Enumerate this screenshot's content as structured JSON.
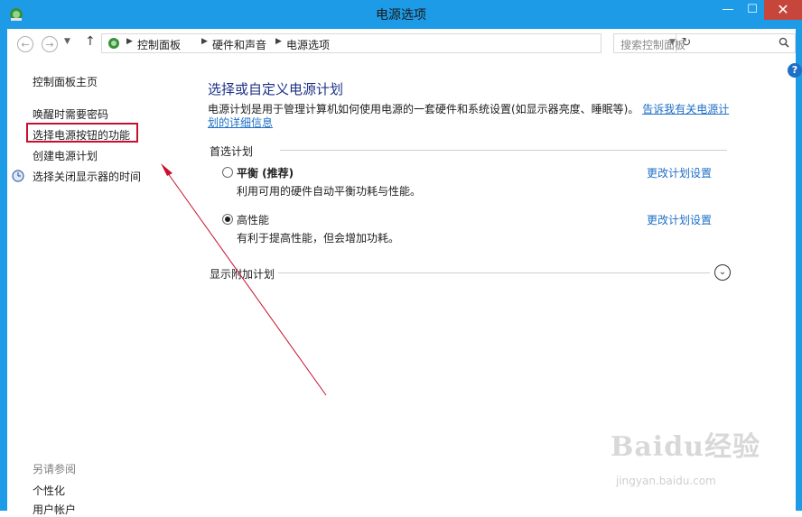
{
  "window": {
    "title": "电源选项",
    "minimize": "—",
    "maximize": "☐",
    "close": "✕"
  },
  "address_bar": {
    "breadcrumbs": [
      "控制面板",
      "硬件和声音",
      "电源选项"
    ],
    "search_placeholder": "搜索控制面板"
  },
  "sidebar": {
    "home": "控制面板主页",
    "links": [
      "唤醒时需要密码",
      "选择电源按钮的功能",
      "创建电源计划",
      "选择关闭显示器的时间"
    ],
    "see_also_title": "另请参阅",
    "see_also": [
      "个性化",
      "用户帐户"
    ]
  },
  "main": {
    "title": "选择或自定义电源计划",
    "description_1": "电源计划是用于管理计算机如何使用电源的一套硬件和系统设置(如显示器亮度、睡眠等)。",
    "description_link_1": "告诉我有关电源计",
    "description_link_2": "划的详细信息",
    "preferred_label": "首选计划",
    "plans": [
      {
        "name": "平衡 (推荐)",
        "desc": "利用可用的硬件自动平衡功耗与性能。",
        "link": "更改计划设置",
        "selected": false
      },
      {
        "name": "高性能",
        "desc": "有利于提高性能，但会增加功耗。",
        "link": "更改计划设置",
        "selected": true
      }
    ],
    "extra_label": "显示附加计划"
  },
  "watermark": {
    "main": "Baidu经验",
    "sub": "jingyan.baidu.com"
  },
  "colors": {
    "titlebar": "#1d9be6",
    "link": "#1e6fc7",
    "heading": "#1e3287",
    "highlight": "#c8102e"
  }
}
